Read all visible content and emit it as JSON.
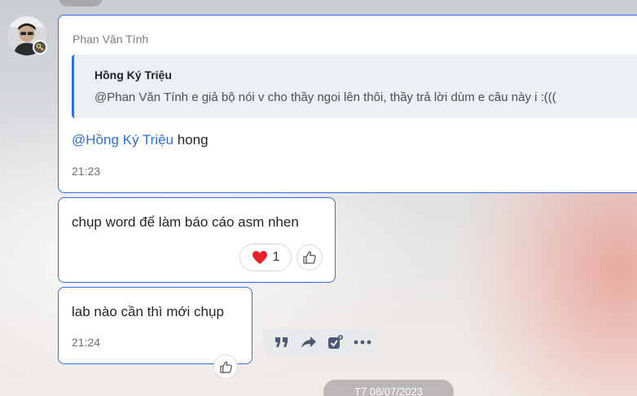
{
  "top_date": "",
  "messages": [
    {
      "sender": "Phan Văn Tính",
      "quote": {
        "author": "Hồng Ký Triệu",
        "text": "@Phan Văn Tính e giả bộ nói v cho thầy ngoi lên thôi, thầy trả lời dùm e câu này i :((("
      },
      "mention": "@Hồng Ký Triệu",
      "text": "hong",
      "time": "21:23"
    },
    {
      "text": "chụp word để làm báo cáo asm nhen",
      "reaction": {
        "icon": "heart-icon",
        "count": "1"
      }
    },
    {
      "text": "lab nào cần thì mới chụp",
      "time": "21:24"
    }
  ],
  "actions": [
    "quote-icon",
    "forward-icon",
    "todo-icon",
    "more-icon"
  ],
  "bottom_date": "T7 08/07/2023",
  "colors": {
    "accent": "#2f6fe0",
    "mention": "#2c6ee0",
    "heart": "#e8202b"
  }
}
